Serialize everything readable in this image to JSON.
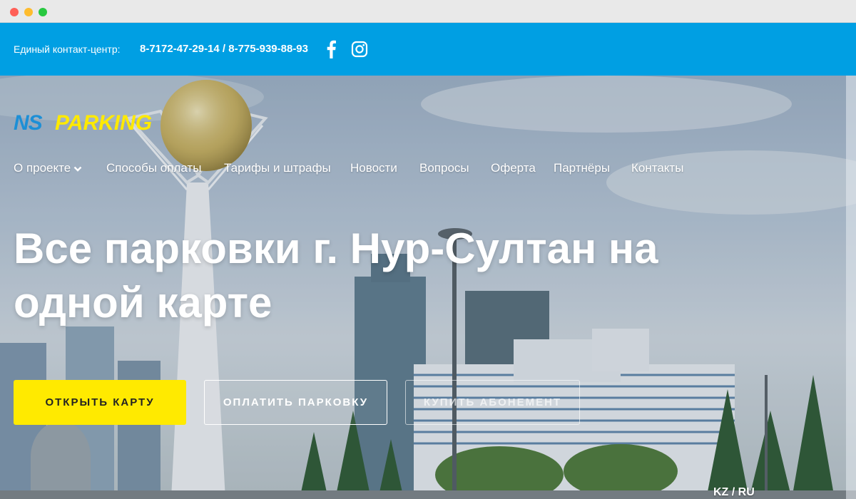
{
  "topbar": {
    "contact_label": "Единый контакт-центр:",
    "phones": "8-7172-47-29-14 / 8-775-939-88-93",
    "facebook_icon": "facebook-icon",
    "instagram_icon": "instagram-icon"
  },
  "logo": {
    "ns": "NS",
    "parking": "PARKING"
  },
  "nav": {
    "items": [
      {
        "label": "О проекте",
        "has_dropdown": true
      },
      {
        "label": "Способы оплаты"
      },
      {
        "label": "Тарифы и штрафы"
      },
      {
        "label": "Новости"
      },
      {
        "label": "Вопросы"
      },
      {
        "label": "Оферта"
      },
      {
        "label": "Партнёры"
      },
      {
        "label": "Контакты"
      }
    ]
  },
  "hero": {
    "headline_line1": "Все парковки г. Нур-Султан на",
    "headline_line2": "одной карте"
  },
  "buttons": {
    "open_map": "ОТКРЫТЬ КАРТУ",
    "pay_parking": "ОПЛАТИТЬ ПАРКОВКУ",
    "buy_subscription": "КУПИТЬ АБОНЕМЕНТ"
  },
  "language": "KZ / RU",
  "colors": {
    "topbar": "#009fe3",
    "accent_yellow": "#ffea00",
    "logo_blue": "#1d8fd6"
  }
}
